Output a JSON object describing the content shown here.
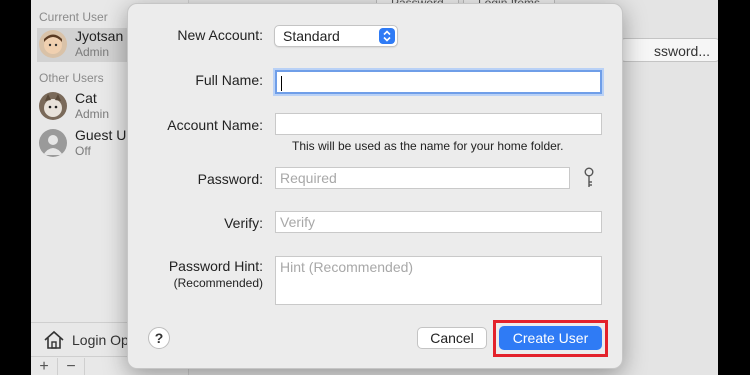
{
  "background": {
    "sidebar": {
      "current_user_header": "Current User",
      "current_user": {
        "name": "Jyotsan",
        "role": "Admin"
      },
      "other_users_header": "Other Users",
      "other_users": [
        {
          "name": "Cat",
          "role": "Admin"
        },
        {
          "name": "Guest U",
          "role": "Off"
        }
      ],
      "login_options_label": "Login Op",
      "add_label": "+",
      "remove_label": "−"
    },
    "tabs": [
      "Password",
      "Login Items"
    ],
    "change_password_button": "ssword..."
  },
  "sheet": {
    "new_account_label": "New Account:",
    "account_type": "Standard",
    "full_name_label": "Full Name:",
    "full_name_value": "",
    "account_name_label": "Account Name:",
    "account_name_value": "",
    "account_name_hint": "This will be used as the name for your home folder.",
    "password_label": "Password:",
    "password_placeholder": "Required",
    "verify_label": "Verify:",
    "verify_placeholder": "Verify",
    "password_hint_label": "Password Hint:",
    "password_hint_sublabel": "(Recommended)",
    "password_hint_placeholder": "Hint (Recommended)",
    "help_label": "?",
    "cancel_label": "Cancel",
    "create_label": "Create User"
  },
  "colors": {
    "accent": "#2f7bf5",
    "highlight": "#e3222b",
    "focus_ring": "#6f9ee8"
  },
  "icons": [
    "house-icon",
    "key-icon",
    "stepper-icon",
    "avatar-icon"
  ]
}
